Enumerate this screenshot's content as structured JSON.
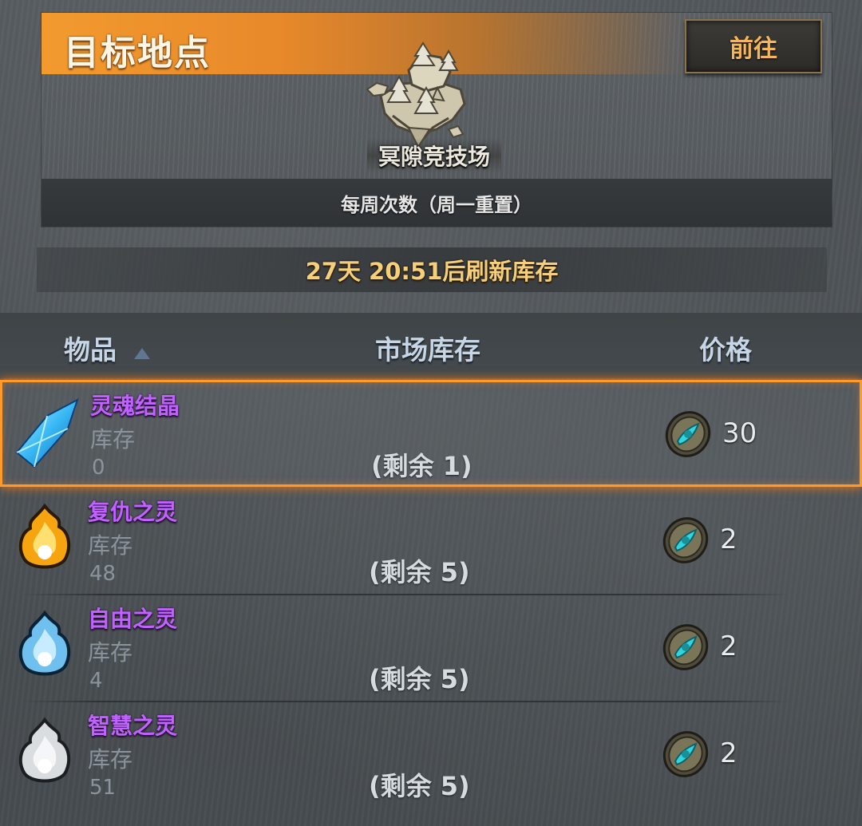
{
  "destination": {
    "title": "目标地点",
    "go_button": "前往",
    "place_name": "冥隙竞技场",
    "weekly_note": "每周次数（周一重置）"
  },
  "refresh": {
    "text": "27天 20:51后刷新库存"
  },
  "table": {
    "headers": {
      "item": "物品",
      "market_stock": "市场库存",
      "price": "价格"
    },
    "rows": [
      {
        "name": "灵魂结晶",
        "stock_label": "库存",
        "stock": "0",
        "remaining": "(剩余 1)",
        "price": "30",
        "icon": "soul-crystal-icon"
      },
      {
        "name": "复仇之灵",
        "stock_label": "库存",
        "stock": "48",
        "remaining": "(剩余 5)",
        "price": "2",
        "icon": "orange-spirit-flame-icon"
      },
      {
        "name": "自由之灵",
        "stock_label": "库存",
        "stock": "4",
        "remaining": "(剩余 5)",
        "price": "2",
        "icon": "blue-spirit-flame-icon"
      },
      {
        "name": "智慧之灵",
        "stock_label": "库存",
        "stock": "51",
        "remaining": "(剩余 5)",
        "price": "2",
        "icon": "white-spirit-flame-icon"
      }
    ]
  },
  "colors": {
    "title_bar": "#f29a2e",
    "item_name": "#c062ff",
    "refresh_text": "#f6cf7a",
    "selection": "#ff9a2a"
  }
}
